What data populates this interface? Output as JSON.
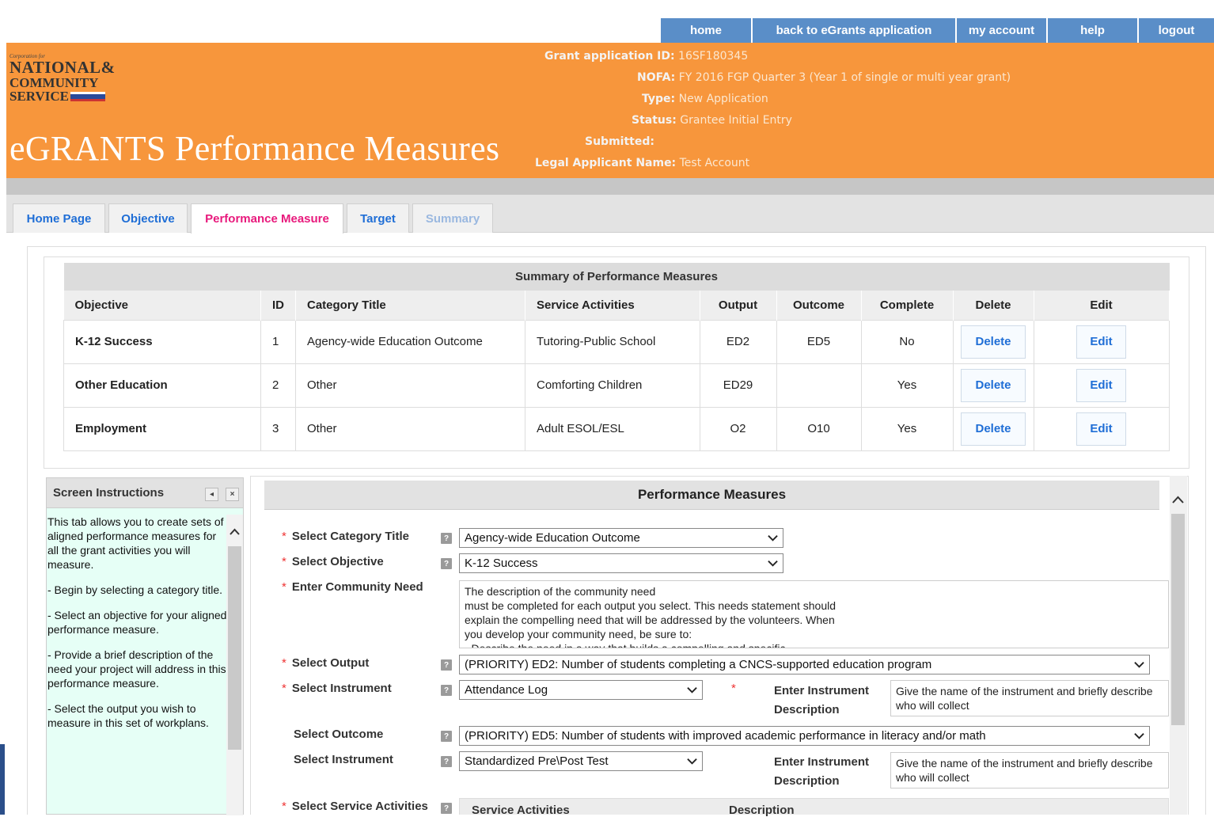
{
  "nav": [
    "home",
    "back to eGrants application",
    "my account",
    "help",
    "logout"
  ],
  "logo": {
    "corp": "Corporation for",
    "line1": "NATIONAL&",
    "line2": "COMMUNITY",
    "line3": "SERVICE"
  },
  "app_title": "eGRANTS Performance Measures",
  "meta": {
    "id_label": "Grant application ID:",
    "id_value": "16SF180345",
    "nofa_label": "NOFA:",
    "nofa_value": "FY 2016 FGP Quarter 3 (Year 1 of single or multi year grant)",
    "type_label": "Type:",
    "type_value": "New Application",
    "status_label": "Status:",
    "status_value": "Grantee Initial Entry",
    "submitted_label": "Submitted:",
    "submitted_value": "",
    "legal_label": "Legal Applicant Name:",
    "legal_value": "Test Account"
  },
  "tabs": [
    "Home Page",
    "Objective",
    "Performance Measure",
    "Target",
    "Summary"
  ],
  "summary": {
    "caption": "Summary of Performance Measures",
    "columns": [
      "Objective",
      "ID",
      "Category Title",
      "Service Activities",
      "Output",
      "Outcome",
      "Complete",
      "Delete",
      "Edit"
    ],
    "rows": [
      [
        "K-12 Success",
        "1",
        "Agency-wide Education Outcome",
        "Tutoring-Public School",
        "ED2",
        "ED5",
        "No",
        "Delete",
        "Edit"
      ],
      [
        "Other Education",
        "2",
        "Other",
        "Comforting Children",
        "ED29",
        "",
        "Yes",
        "Delete",
        "Edit"
      ],
      [
        "Employment",
        "3",
        "Other",
        "Adult ESOL/ESL",
        "O2",
        "O10",
        "Yes",
        "Delete",
        "Edit"
      ]
    ]
  },
  "instructions": {
    "title": "Screen Instructions",
    "collapse_icon": "◂",
    "close_icon": "×",
    "paragraphs": [
      "This tab allows you to create sets of aligned performance measures for all the grant activities you will measure.",
      "- Begin by selecting a category title.",
      "- Select an objective for your aligned performance measure.",
      "- Provide a brief description of the need your project will address in this performance measure.",
      "- Select the output you wish to measure in this set of workplans."
    ]
  },
  "form": {
    "title": "Performance Measures",
    "required_mark": "*",
    "help_mark": "?",
    "category_label": "Select Category Title",
    "category_value": "Agency-wide Education Outcome",
    "objective_label": "Select Objective",
    "objective_value": "K-12 Success",
    "need_label": "Enter Community Need",
    "need_text": "The description of the community need\nmust be completed for each output you select. This needs statement should\nexplain the compelling need that will be addressed by the volunteers. When\nyou develop your community need, be sure to:\n- Describe the need in a way that builds a compelling and specific",
    "output_label": "Select Output",
    "output_value": "(PRIORITY) ED2: Number of students completing a CNCS-supported education program",
    "instrument1_label": "Select Instrument",
    "instrument1_value": "Attendance Log",
    "instr_desc1_label": "Enter Instrument Description",
    "instr_desc1_text": "Give the name of the instrument and briefly describe who will collect\nthe data, from whom, and when it will be collected.",
    "outcome_label": "Select Outcome",
    "outcome_value": "(PRIORITY) ED5: Number of students with improved academic performance in literacy and/or math",
    "instrument2_label": "Select Instrument",
    "instrument2_value": "Standardized Pre\\Post Test",
    "instr_desc2_label": "Enter Instrument Description",
    "instr_desc2_text": "Give the name of the instrument and briefly describe who will collect\nthe data, from whom, and when it will be collected.",
    "service_label": "Select Service Activities",
    "service_col1": "Service Activities",
    "service_col2": "Description"
  },
  "colors": {
    "orange": "#f7963c",
    "nav_blue": "#5a8ec8",
    "active_tab": "#e8197c",
    "link_blue": "#1f6ed6",
    "instr_bg": "#e6fff6"
  }
}
